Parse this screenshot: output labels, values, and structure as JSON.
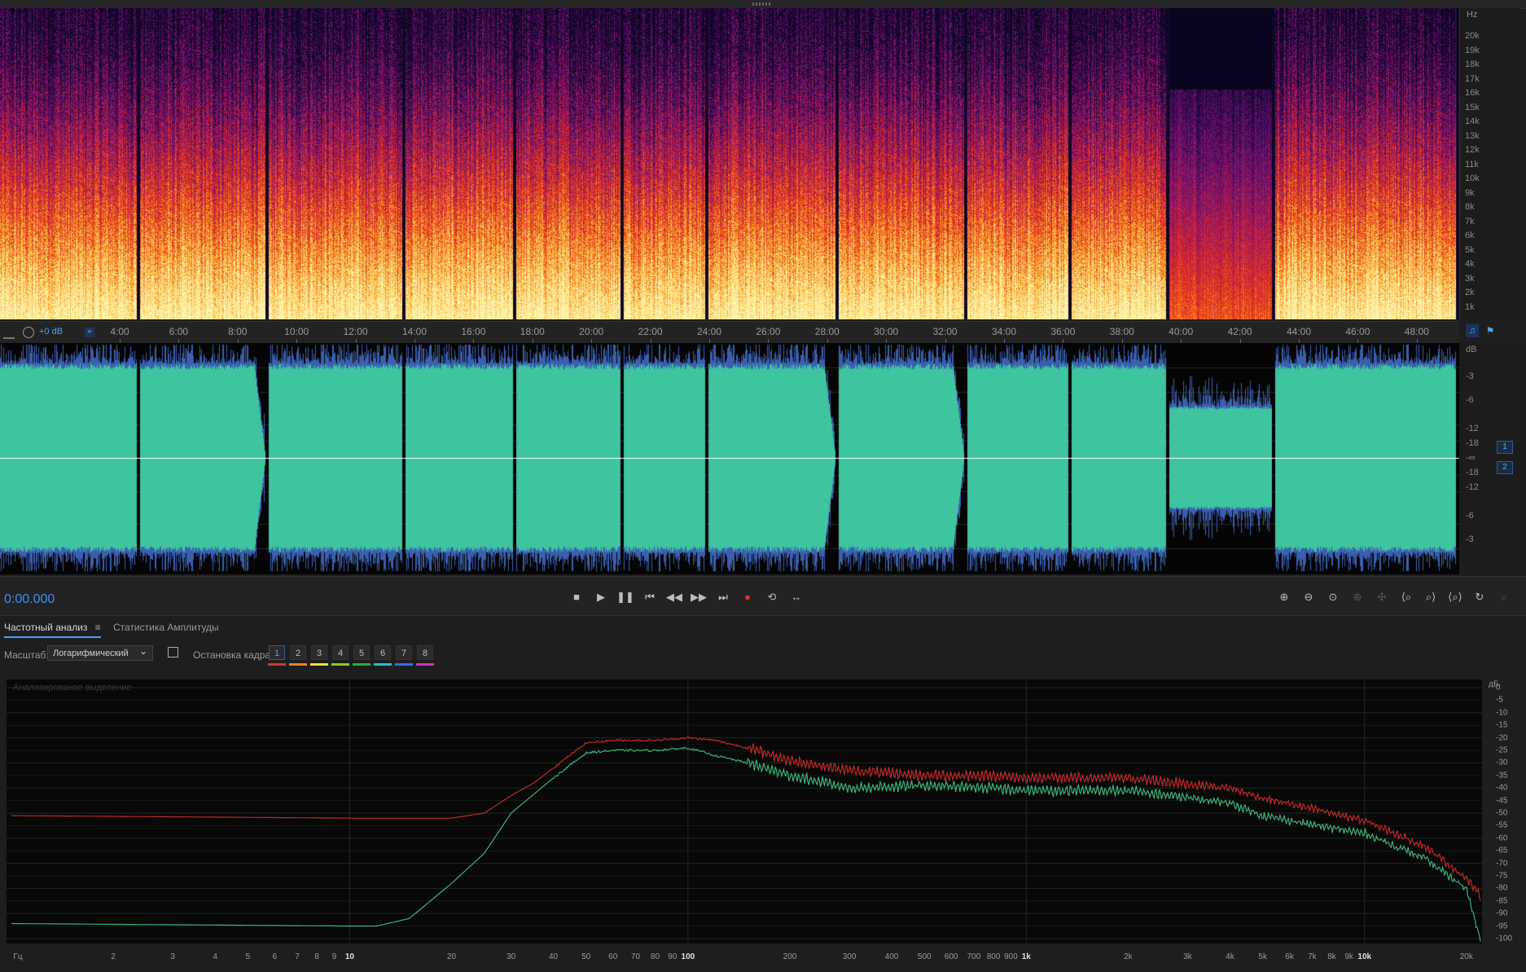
{
  "spectrogram": {
    "unit_label": "Hz",
    "freq_labels": [
      "20k",
      "19k",
      "18k",
      "17k",
      "16k",
      "15k",
      "14k",
      "13k",
      "12k",
      "11k",
      "10k",
      "9k",
      "8k",
      "7k",
      "6k",
      "5k",
      "4k",
      "3k",
      "2k",
      "1k"
    ]
  },
  "timeline": {
    "gain_label": "+0 dB",
    "ticks": [
      "4:00",
      "6:00",
      "8:00",
      "10:00",
      "12:00",
      "14:00",
      "16:00",
      "18:00",
      "20:00",
      "22:00",
      "24:00",
      "26:00",
      "28:00",
      "30:00",
      "32:00",
      "34:00",
      "36:00",
      "38:00",
      "40:00",
      "42:00",
      "44:00",
      "46:00",
      "48:00"
    ]
  },
  "waveform": {
    "unit_label": "dB",
    "scale_labels": [
      "-3",
      "-6",
      "-12",
      "-18",
      "-∞",
      "-18",
      "-12",
      "-6",
      "-3"
    ],
    "channels": [
      "1",
      "2"
    ],
    "color": "#3fc4a0"
  },
  "transport": {
    "timecode": "0:00.000"
  },
  "panel": {
    "tabs": [
      {
        "label": "Частотный анализ"
      },
      {
        "label": "Статистика Амплитуды"
      }
    ],
    "scale_label": "Масштаб:",
    "scale_value": "Логарифмический",
    "freeze_label": "Остановка кадра:",
    "frames": [
      {
        "label": "1",
        "color": "#e03030"
      },
      {
        "label": "2",
        "color": "#f08020"
      },
      {
        "label": "3",
        "color": "#f0e020"
      },
      {
        "label": "4",
        "color": "#80d020"
      },
      {
        "label": "5",
        "color": "#20b040"
      },
      {
        "label": "6",
        "color": "#20c0d0"
      },
      {
        "label": "7",
        "color": "#3070f0"
      },
      {
        "label": "8",
        "color": "#d030c0"
      }
    ],
    "analyzed_label": "Анализированое выделение"
  },
  "chart_data": {
    "type": "line",
    "xscale": "log",
    "xlim": [
      1,
      22000
    ],
    "ylim": [
      -100,
      0
    ],
    "xlabel": "Гц",
    "ylabel": "дБ",
    "x_tick_labels": [
      "Гц",
      "2",
      "3",
      "4",
      "5",
      "6",
      "7",
      "8",
      "9",
      "10",
      "20",
      "30",
      "40",
      "50",
      "60",
      "70",
      "80",
      "90",
      "100",
      "200",
      "300",
      "400",
      "500",
      "600",
      "700",
      "800",
      "900",
      "1k",
      "2k",
      "3k",
      "4k",
      "5k",
      "6k",
      "7k",
      "8k",
      "9k",
      "10k",
      "20k"
    ],
    "y_tick_labels": [
      "дБ",
      "0",
      "-5",
      "-10",
      "-15",
      "-20",
      "-25",
      "-30",
      "-35",
      "-40",
      "-45",
      "-50",
      "-55",
      "-60",
      "-65",
      "-70",
      "-75",
      "-80",
      "-85",
      "-90",
      "-95",
      "-100"
    ],
    "series": [
      {
        "color": "#c02828",
        "x": [
          1,
          10,
          20,
          25,
          30,
          35,
          40,
          50,
          60,
          80,
          100,
          120,
          150,
          200,
          300,
          500,
          800,
          1000,
          2000,
          4000,
          5000,
          8000,
          10000,
          15000,
          20000,
          22000
        ],
        "y": [
          -51,
          -52,
          -52,
          -50,
          -43,
          -38,
          -32,
          -22,
          -21,
          -21,
          -20,
          -21,
          -24,
          -29,
          -33,
          -35,
          -35,
          -36,
          -36,
          -40,
          -44,
          -50,
          -53,
          -63,
          -76,
          -83
        ]
      },
      {
        "color": "#3cb07a",
        "x": [
          1,
          10,
          12,
          15,
          20,
          25,
          30,
          40,
          50,
          60,
          80,
          100,
          120,
          150,
          200,
          300,
          500,
          800,
          1000,
          2000,
          4000,
          5000,
          8000,
          10000,
          15000,
          20000,
          22000
        ],
        "y": [
          -94,
          -95,
          -95,
          -92,
          -78,
          -66,
          -50,
          -36,
          -26,
          -25,
          -25,
          -24,
          -27,
          -30,
          -35,
          -40,
          -39,
          -40,
          -41,
          -41,
          -46,
          -51,
          -56,
          -58,
          -68,
          -80,
          -100
        ]
      }
    ]
  }
}
